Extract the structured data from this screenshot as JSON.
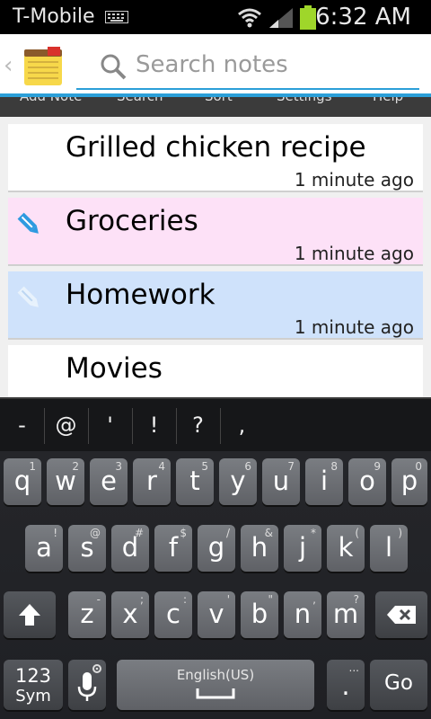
{
  "status": {
    "carrier": "T-Mobile",
    "time": "6:32 AM"
  },
  "actionbar": {
    "search_placeholder": "Search notes"
  },
  "menu": [
    "Add Note",
    "Search",
    "Sort",
    "Settings",
    "Help"
  ],
  "notes": [
    {
      "title": "Grilled chicken recipe",
      "time": "1 minute ago",
      "color": "#ffffff",
      "icon": ""
    },
    {
      "title": "Groceries",
      "time": "1 minute ago",
      "color": "#fde1f7",
      "icon": "pencil-icon"
    },
    {
      "title": "Homework",
      "time": "1 minute ago",
      "color": "#cfe2fb",
      "icon": "pencil-icon"
    },
    {
      "title": "Movies",
      "time": "",
      "color": "#ffffff",
      "icon": ""
    }
  ],
  "suggestions": [
    "-",
    "@",
    "'",
    "!",
    "?",
    ","
  ],
  "keyboard": {
    "row1": [
      {
        "k": "q",
        "h": "1"
      },
      {
        "k": "w",
        "h": "2"
      },
      {
        "k": "e",
        "h": "3"
      },
      {
        "k": "r",
        "h": "4"
      },
      {
        "k": "t",
        "h": "5"
      },
      {
        "k": "y",
        "h": "6"
      },
      {
        "k": "u",
        "h": "7"
      },
      {
        "k": "i",
        "h": "8"
      },
      {
        "k": "o",
        "h": "9"
      },
      {
        "k": "p",
        "h": "0"
      }
    ],
    "row2": [
      {
        "k": "a",
        "h": "!"
      },
      {
        "k": "s",
        "h": "@"
      },
      {
        "k": "d",
        "h": "#"
      },
      {
        "k": "f",
        "h": "$"
      },
      {
        "k": "g",
        "h": "/"
      },
      {
        "k": "h",
        "h": "&"
      },
      {
        "k": "j",
        "h": "*"
      },
      {
        "k": "k",
        "h": "("
      },
      {
        "k": "l",
        "h": ")"
      }
    ],
    "row3": [
      {
        "k": "z",
        "h": "-"
      },
      {
        "k": "x",
        "h": ";"
      },
      {
        "k": "c",
        "h": ":"
      },
      {
        "k": "v",
        "h": "'"
      },
      {
        "k": "b",
        "h": "\""
      },
      {
        "k": "n",
        "h": ","
      },
      {
        "k": "m",
        "h": "?"
      }
    ],
    "sym_top": "123",
    "sym_bottom": "Sym",
    "space": "English(US)",
    "period": ".",
    "period_hint": "...",
    "go": "Go"
  }
}
